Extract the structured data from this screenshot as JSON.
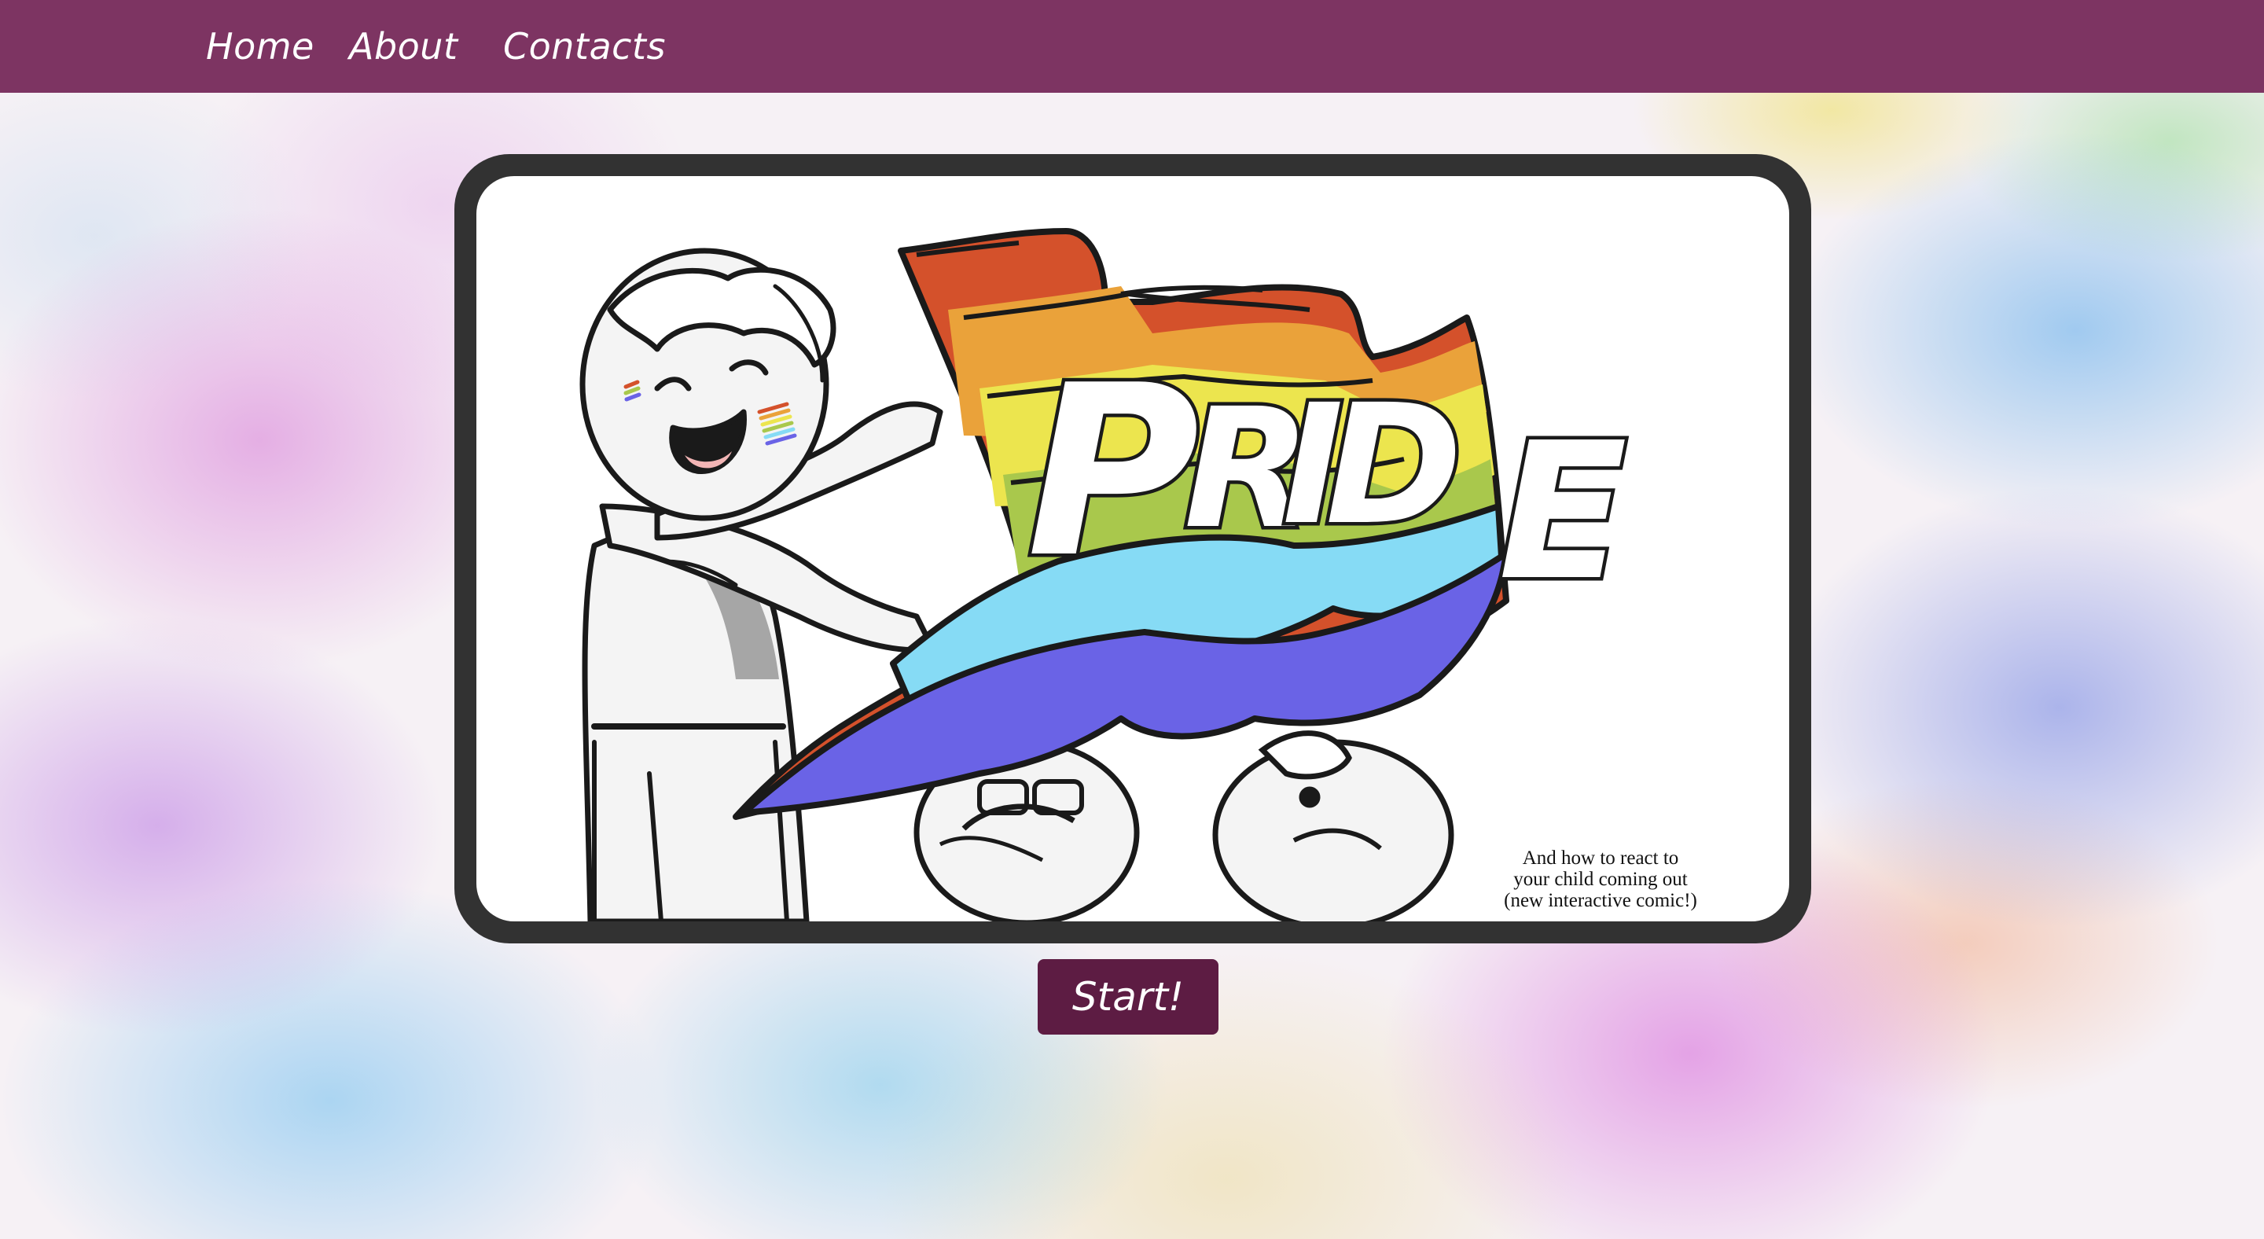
{
  "nav": {
    "items": [
      {
        "label": "Home"
      },
      {
        "label": "About"
      },
      {
        "label": "Contacts"
      }
    ]
  },
  "hero": {
    "flag_word": "PRIDE",
    "subtitle_lines": [
      "And how to react to",
      "your child coming out",
      "(new interactive comic!)"
    ]
  },
  "start_button": {
    "label": "Start!"
  },
  "colors": {
    "nav_bg": "#7d3462",
    "button_bg": "#5d1c43",
    "frame_border": "#323232",
    "flag_stripes": [
      "#d4512b",
      "#eaa23a",
      "#ece54e",
      "#a9c84c",
      "#86dbf5",
      "#6a63e6"
    ]
  }
}
